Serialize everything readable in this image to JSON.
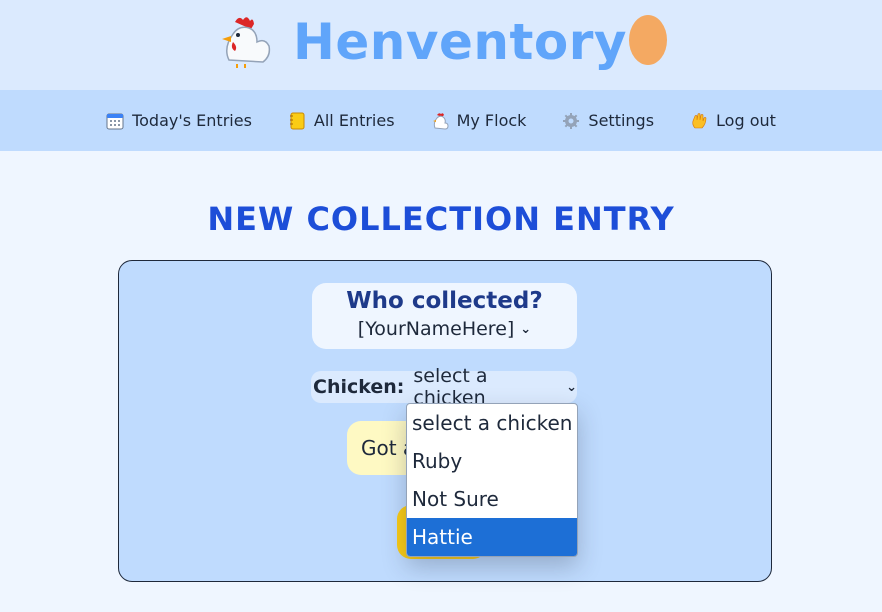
{
  "app": {
    "title": "Henventory",
    "logo_left_icon": "chicken-icon",
    "logo_right_icon": "egg-icon"
  },
  "nav": {
    "items": [
      {
        "label": "Today's Entries",
        "icon": "calendar-icon"
      },
      {
        "label": "All Entries",
        "icon": "notebook-icon"
      },
      {
        "label": "My Flock",
        "icon": "chicken-icon"
      },
      {
        "label": "Settings",
        "icon": "gear-icon"
      },
      {
        "label": "Log out",
        "icon": "waving-hand-icon"
      }
    ]
  },
  "page": {
    "title": "NEW COLLECTION ENTRY"
  },
  "form": {
    "who_label": "Who collected?",
    "who_value": "[YourNameHere]",
    "chicken_label": "Chicken:",
    "chicken_value": "select a chicken",
    "got_button_label": "Got a",
    "chicken_options": [
      {
        "label": "select a chicken",
        "selected": false
      },
      {
        "label": "Ruby",
        "selected": false
      },
      {
        "label": "Not Sure",
        "selected": false
      },
      {
        "label": "Hattie",
        "selected": true
      }
    ]
  },
  "colors": {
    "header_bg": "#dbeafe",
    "nav_bg": "#bfdbfe",
    "page_bg": "#eff6ff",
    "title_blue": "#60a5fa",
    "heading_blue": "#1d4ed8",
    "got_button_bg": "#fef9c3",
    "submit_button_bg": "#facc15",
    "highlight": "#1d6fd6"
  }
}
